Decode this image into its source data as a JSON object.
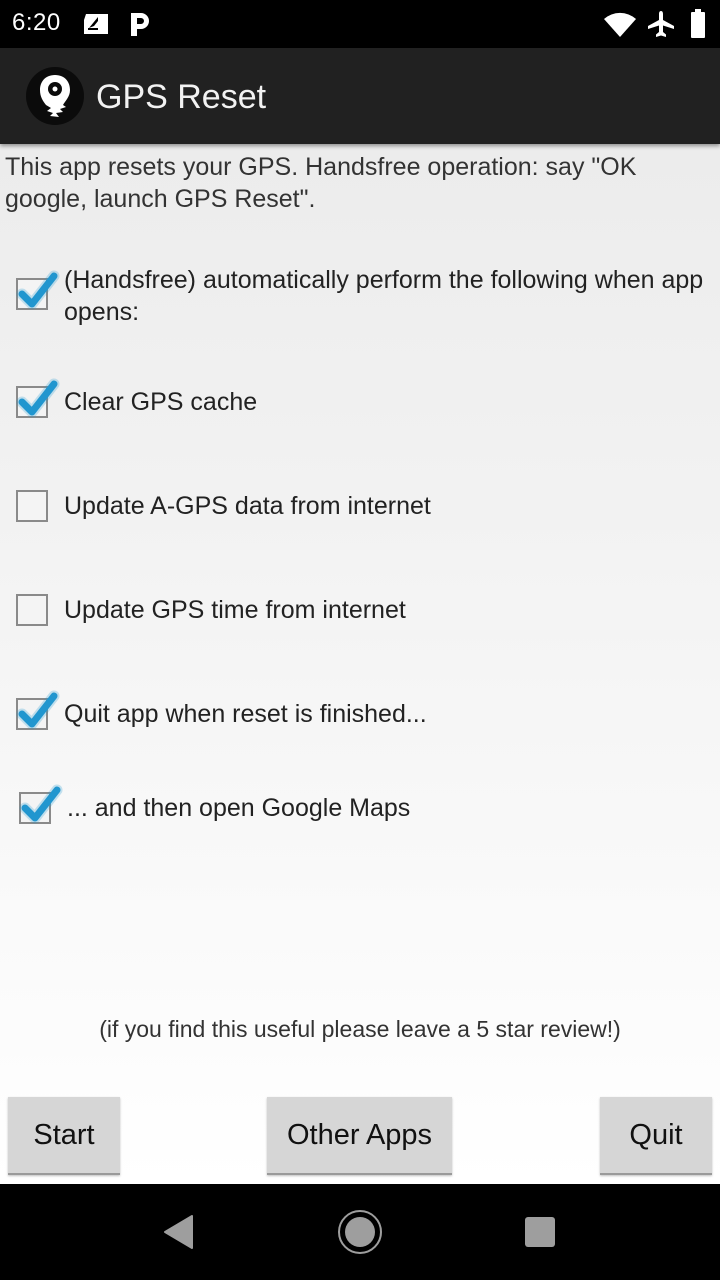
{
  "status_bar": {
    "time": "6:20",
    "left_icons": [
      "sim-card-icon",
      "parking-icon"
    ],
    "right_icons": [
      "wifi-icon",
      "airplane-mode-icon",
      "battery-icon"
    ]
  },
  "app_bar": {
    "logo_icon": "gps-reset-logo-icon",
    "title": "GPS Reset"
  },
  "intro_text": "This app resets your GPS. Handsfree operation: say \"OK google, launch GPS Reset\".",
  "options": [
    {
      "label": "(Handsfree) automatically perform the following when app opens:",
      "checked": true
    },
    {
      "label": "Clear GPS cache",
      "checked": true
    },
    {
      "label": "Update A-GPS data from internet",
      "checked": false
    },
    {
      "label": "Update GPS time from internet",
      "checked": false
    },
    {
      "label": "Quit app when reset is finished...",
      "checked": true
    },
    {
      "label": "... and then open Google Maps",
      "checked": true
    }
  ],
  "footer_note": "(if you find this useful please leave a 5 star review!)",
  "buttons": {
    "start": "Start",
    "other_apps": "Other Apps",
    "quit": "Quit"
  },
  "nav_bar": {
    "back": "back-icon",
    "home": "home-icon",
    "recents": "recents-icon"
  },
  "colors": {
    "checkmark": "#2196cf",
    "app_bar": "#212121",
    "button": "#d6d6d6"
  }
}
